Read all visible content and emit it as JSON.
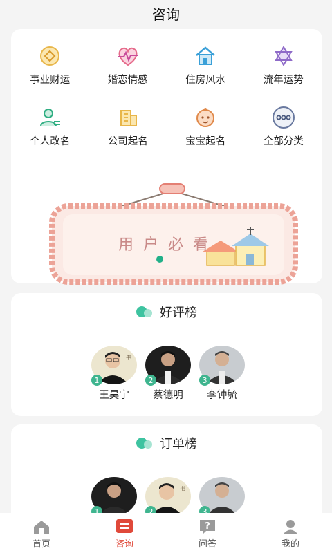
{
  "header": {
    "title": "咨询"
  },
  "categories": [
    {
      "label": "事业财运",
      "icon": "coin-icon",
      "color": "#e8b64a"
    },
    {
      "label": "婚恋情感",
      "icon": "heart-pulse-icon",
      "color": "#e56a8a"
    },
    {
      "label": "住房风水",
      "icon": "house-icon",
      "color": "#3aa0d8"
    },
    {
      "label": "流年运势",
      "icon": "star-of-david-icon",
      "color": "#8e6ac8"
    },
    {
      "label": "个人改名",
      "icon": "person-edit-icon",
      "color": "#2fae82"
    },
    {
      "label": "公司起名",
      "icon": "building-icon",
      "color": "#e8b64a"
    },
    {
      "label": "宝宝起名",
      "icon": "baby-face-icon",
      "color": "#e0894a"
    },
    {
      "label": "全部分类",
      "icon": "more-dots-icon",
      "color": "#6a7aa0"
    }
  ],
  "banner": {
    "text": "用户必看"
  },
  "rank_good": {
    "title": "好评榜",
    "people": [
      {
        "rank": "1",
        "name": "王昊宇"
      },
      {
        "rank": "2",
        "name": "蔡德明"
      },
      {
        "rank": "3",
        "name": "李钟毓"
      }
    ]
  },
  "rank_order": {
    "title": "订单榜",
    "people": [
      {
        "rank": "1",
        "name": ""
      },
      {
        "rank": "2",
        "name": ""
      },
      {
        "rank": "3",
        "name": ""
      }
    ]
  },
  "tabbar": [
    {
      "label": "首页",
      "icon": "home-icon"
    },
    {
      "label": "咨询",
      "icon": "chat-list-icon",
      "active": true
    },
    {
      "label": "问答",
      "icon": "question-icon"
    },
    {
      "label": "我的",
      "icon": "user-icon"
    }
  ],
  "colors": {
    "accent": "#e0493a",
    "green": "#22b089",
    "badge": "#3fb58f"
  }
}
